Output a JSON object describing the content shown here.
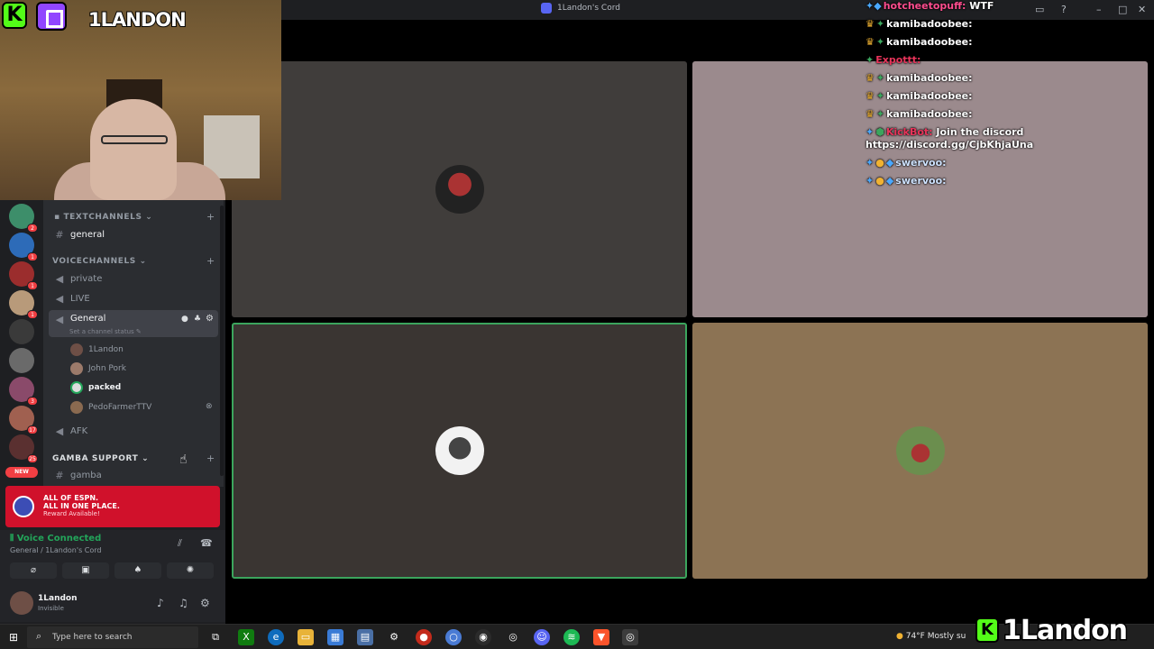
{
  "window": {
    "title": "1Landon's Cord"
  },
  "overlay": {
    "brand_top": "1LANDON",
    "brand_bottom": "1Landon",
    "brand_k": "K"
  },
  "servers": [
    {
      "color": "#3d8e6a",
      "count": "2"
    },
    {
      "color": "#2d6bb8",
      "count": "1"
    },
    {
      "color": "#9b2d2d",
      "count": "1"
    },
    {
      "color": "#b89a7a",
      "count": "1"
    },
    {
      "color": "#3a3a3a",
      "count": ""
    },
    {
      "color": "#6a6a6a",
      "count": ""
    },
    {
      "color": "#8a4a6a",
      "count": "3"
    },
    {
      "color": "#a06050",
      "count": "17"
    },
    {
      "color": "#5a3030",
      "count": "25"
    }
  ],
  "new_badge": "NEW",
  "channels": {
    "text_category": "TEXTCHANNELS",
    "text_channels": [
      "general"
    ],
    "voice_category": "VOICECHANNELS",
    "voice_channels": [
      "private",
      "LIVE"
    ],
    "active_channel": "General",
    "channel_status": "Set a channel status",
    "members": [
      "1Landon",
      "John Pork",
      "packed",
      "PedoFarmerTTV"
    ],
    "afk": "AFK",
    "support_category": "GAMBA SUPPORT",
    "support_channels": [
      "gamba"
    ]
  },
  "promo": {
    "line1": "ALL OF ESPN.",
    "line1b": "ALL IN ONE PLACE.",
    "line2": "Reward Available!"
  },
  "voice": {
    "connected": "Voice Connected",
    "server": "General / 1Landon's Cord"
  },
  "user": {
    "name": "1Landon",
    "status": "Invisible"
  },
  "chat": [
    {
      "user": "hotcheetopuff:",
      "text": "WTF",
      "color": "#ff4d8f"
    },
    {
      "user": "kamibadoobee:",
      "text": "",
      "color": "#dbdee1"
    },
    {
      "user": "kamibadoobee:",
      "text": "",
      "color": "#dbdee1"
    },
    {
      "user": "Expottt:",
      "text": "",
      "color": "#e8345a"
    },
    {
      "user": "kamibadoobee:",
      "text": "",
      "color": "#dbdee1"
    },
    {
      "user": "kamibadoobee:",
      "text": "",
      "color": "#dbdee1"
    },
    {
      "user": "kamibadoobee:",
      "text": "",
      "color": "#dbdee1"
    },
    {
      "user": "KickBot:",
      "text": "Join the discord",
      "color": "#e8345a"
    },
    {
      "user": "",
      "text": "https://discord.gg/CjbKhjaUna",
      "color": "#dbdee1"
    },
    {
      "user": "swervoo:",
      "text": "",
      "color": "#dbdee1"
    },
    {
      "user": "swervoo:",
      "text": "",
      "color": "#dbdee1"
    }
  ],
  "taskbar": {
    "search_placeholder": "Type here to search",
    "weather": "74°F  Mostly su"
  },
  "colors": {
    "accent": "#5865f2",
    "online": "#23a55a",
    "alert": "#f23f43",
    "kick": "#53fc18",
    "twitch": "#9146ff"
  }
}
